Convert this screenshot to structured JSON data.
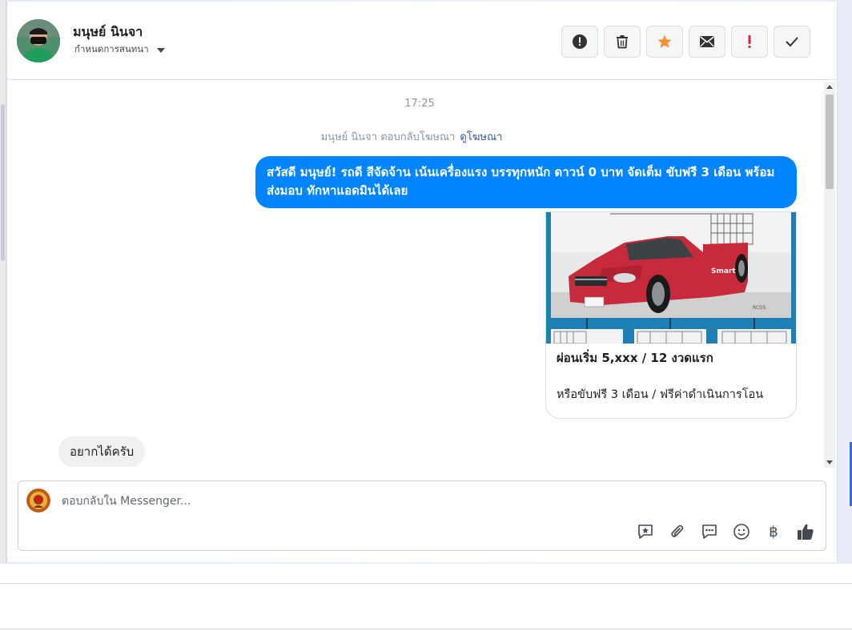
{
  "header": {
    "contact_name": "มนุษย์ นินจา",
    "label_dropdown": "กำหนดการสนทนา"
  },
  "actions": [
    {
      "name": "mark-spam-button",
      "icon": "alert-circle-icon"
    },
    {
      "name": "delete-button",
      "icon": "trash-icon"
    },
    {
      "name": "star-button",
      "icon": "star-icon",
      "color": "#f7923b"
    },
    {
      "name": "mark-unread-button",
      "icon": "envelope-icon"
    },
    {
      "name": "follow-up-button",
      "icon": "exclamation-icon",
      "color": "#e41e3f"
    },
    {
      "name": "mark-done-button",
      "icon": "check-icon"
    }
  ],
  "thread": {
    "timestamp": "17:25",
    "reply_note": "มนุษย์ นินจา ตอบกลับโฆษณา",
    "reply_note_link": "ดูโฆษณา",
    "outgoing_message": "สวัสดี มนุษย์! รถดี สีจัดจ้าน เน้นเครื่องแรง บรรทุกหนัก ดาวน์ 0 บาท จัดเต็ม ขับฟรี 3 เดือน พร้อมส่งมอบ ทักหาแอดมินได้เลย",
    "ad_card": {
      "title": "ผ่อนเริ่ม 5,xxx / 12 งวดแรก",
      "subtitle": "หรือขับฟรี 3 เดือน / ฟรีค่าดำเนินการโอน"
    },
    "incoming_message": "อยากได้ครับ"
  },
  "composer": {
    "placeholder": "ตอบกลับใน Messenger..."
  },
  "tools": [
    {
      "name": "saved-reply-button",
      "icon": "star-chat-icon"
    },
    {
      "name": "attach-button",
      "icon": "paperclip-icon"
    },
    {
      "name": "quick-reply-button",
      "icon": "chat-dots-icon"
    },
    {
      "name": "emoji-button",
      "icon": "smiley-icon"
    },
    {
      "name": "payment-button",
      "icon": "baht-icon",
      "glyph": "฿"
    },
    {
      "name": "like-button",
      "icon": "thumbs-up-icon"
    }
  ],
  "colors": {
    "accent": "#0084ff",
    "incoming_bubble": "#f0f0f0"
  }
}
